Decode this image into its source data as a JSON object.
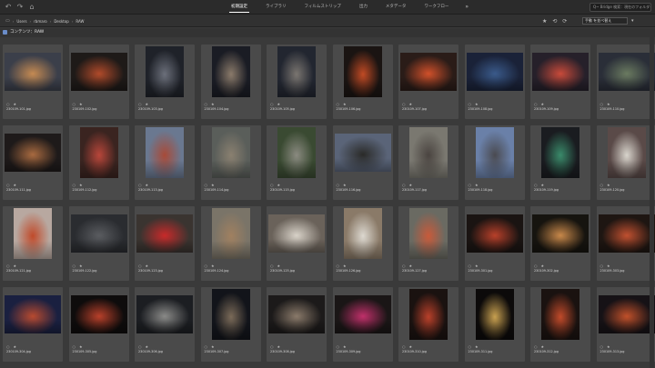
{
  "toolbar": {
    "tabs": [
      "初期設定",
      "ライブラリ",
      "フィルムストリップ",
      "出力",
      "メタデータ",
      "ワークフロー"
    ],
    "active_tab": 0,
    "more": "»",
    "search_placeholder": "Q~ Bridge 検索：現在のフォルダー"
  },
  "path": {
    "crumbs": [
      "Users",
      "rbmaro",
      "Desktop",
      "RAW"
    ]
  },
  "sort": {
    "label": "手動 を並べ替え",
    "direction": "▾"
  },
  "panel": {
    "title": "コンテンツ：RAW"
  },
  "icons": {
    "back": "undo-icon",
    "forward": "redo-icon",
    "home": "home-icon",
    "star": "star-icon",
    "label": "label-icon",
    "rotate": "rotate-icon",
    "new": "new-folder-icon",
    "delete": "trash-icon"
  },
  "thumbnails": [
    {
      "file": "230109-101.jpg",
      "orient": "land",
      "bg": "#3b3f4a",
      "fg": "#c58a52"
    },
    {
      "file": "230109-102.jpg",
      "orient": "land",
      "bg": "#1e1a18",
      "fg": "#b04a2a"
    },
    {
      "file": "230109-103.jpg",
      "orient": "port",
      "bg": "#1f2229",
      "fg": "#6b6f7a"
    },
    {
      "file": "230109-104.jpg",
      "orient": "port",
      "bg": "#1a1c24",
      "fg": "#8a7a6a"
    },
    {
      "file": "230109-105.jpg",
      "orient": "port",
      "bg": "#222630",
      "fg": "#7a7570"
    },
    {
      "file": "230109-106.jpg",
      "orient": "port",
      "bg": "#1a1412",
      "fg": "#c04a24"
    },
    {
      "file": "230109-107.jpg",
      "orient": "land",
      "bg": "#2a1c18",
      "fg": "#d0502a"
    },
    {
      "file": "230109-108.jpg",
      "orient": "land",
      "bg": "#1a2238",
      "fg": "#3a5a8a"
    },
    {
      "file": "230109-109.jpg",
      "orient": "land",
      "bg": "#26202a",
      "fg": "#c84a3a"
    },
    {
      "file": "230109-110.jpg",
      "orient": "land",
      "bg": "#2a2e38",
      "fg": "#6a7a60"
    },
    {
      "file": "230109-111.jpg",
      "orient": "land",
      "bg": "#1e1a1a",
      "fg": "#a86a40"
    },
    {
      "file": "230109-112.jpg",
      "orient": "port",
      "bg": "#3a2420",
      "fg": "#b8463a"
    },
    {
      "file": "230109-113.jpg",
      "orient": "port",
      "bg": "#6a7890",
      "fg": "#a84a38"
    },
    {
      "file": "230109-114.jpg",
      "orient": "port",
      "bg": "#5a5e5a",
      "fg": "#8a8070"
    },
    {
      "file": "230109-115.jpg",
      "orient": "port",
      "bg": "#3a4a32",
      "fg": "#8a8a80"
    },
    {
      "file": "230109-116.jpg",
      "orient": "land",
      "bg": "#5a6478",
      "fg": "#2a2a28"
    },
    {
      "file": "230109-117.jpg",
      "orient": "port",
      "bg": "#7a7870",
      "fg": "#4a4440"
    },
    {
      "file": "230109-118.jpg",
      "orient": "port",
      "bg": "#6a80a8",
      "fg": "#4a4a50"
    },
    {
      "file": "230109-119.jpg",
      "orient": "port",
      "bg": "#1a1c20",
      "fg": "#3a8a6a"
    },
    {
      "file": "230109-120.jpg",
      "orient": "port",
      "bg": "#5a4a48",
      "fg": "#d8d4cc"
    },
    {
      "file": "230109-121.jpg",
      "orient": "port",
      "bg": "#b8a8a0",
      "fg": "#c04a2a"
    },
    {
      "file": "230109-122.jpg",
      "orient": "land",
      "bg": "#2a2c30",
      "fg": "#5a5c60"
    },
    {
      "file": "230109-123.jpg",
      "orient": "land",
      "bg": "#3a3430",
      "fg": "#c82a2a"
    },
    {
      "file": "230109-124.jpg",
      "orient": "port",
      "bg": "#7a7468",
      "fg": "#a08060"
    },
    {
      "file": "230109-125.jpg",
      "orient": "land",
      "bg": "#6a625a",
      "fg": "#d8d2c8"
    },
    {
      "file": "230109-126.jpg",
      "orient": "port",
      "bg": "#8a7a68",
      "fg": "#dcd8d0"
    },
    {
      "file": "230109-127.jpg",
      "orient": "port",
      "bg": "#6a6a62",
      "fg": "#c85a3a"
    },
    {
      "file": "230109-301.jpg",
      "orient": "land",
      "bg": "#1a1412",
      "fg": "#b8402a"
    },
    {
      "file": "230109-302.jpg",
      "orient": "land",
      "bg": "#16140f",
      "fg": "#c8884a"
    },
    {
      "file": "230109-303.jpg",
      "orient": "land",
      "bg": "#1e1612",
      "fg": "#c05030"
    },
    {
      "file": "230109-304.jpg",
      "orient": "land",
      "bg": "#1a2040",
      "fg": "#b84a30"
    },
    {
      "file": "230109-305.jpg",
      "orient": "land",
      "bg": "#0e0c0c",
      "fg": "#b8402a"
    },
    {
      "file": "230109-306.jpg",
      "orient": "land",
      "bg": "#1c1e22",
      "fg": "#8a8a88"
    },
    {
      "file": "230109-307.jpg",
      "orient": "port",
      "bg": "#12141a",
      "fg": "#7a6a58"
    },
    {
      "file": "230109-308.jpg",
      "orient": "land",
      "bg": "#1c1a1a",
      "fg": "#8a7a6a"
    },
    {
      "file": "230109-309.jpg",
      "orient": "land",
      "bg": "#1a1616",
      "fg": "#c0306a"
    },
    {
      "file": "230109-310.jpg",
      "orient": "port",
      "bg": "#1a1210",
      "fg": "#b8402a"
    },
    {
      "file": "230109-311.jpg",
      "orient": "port",
      "bg": "#0c0a0a",
      "fg": "#c8a050"
    },
    {
      "file": "230109-312.jpg",
      "orient": "port",
      "bg": "#1a1210",
      "fg": "#c04a2a"
    },
    {
      "file": "230109-313.jpg",
      "orient": "land",
      "bg": "#161216",
      "fg": "#c0502a"
    }
  ]
}
